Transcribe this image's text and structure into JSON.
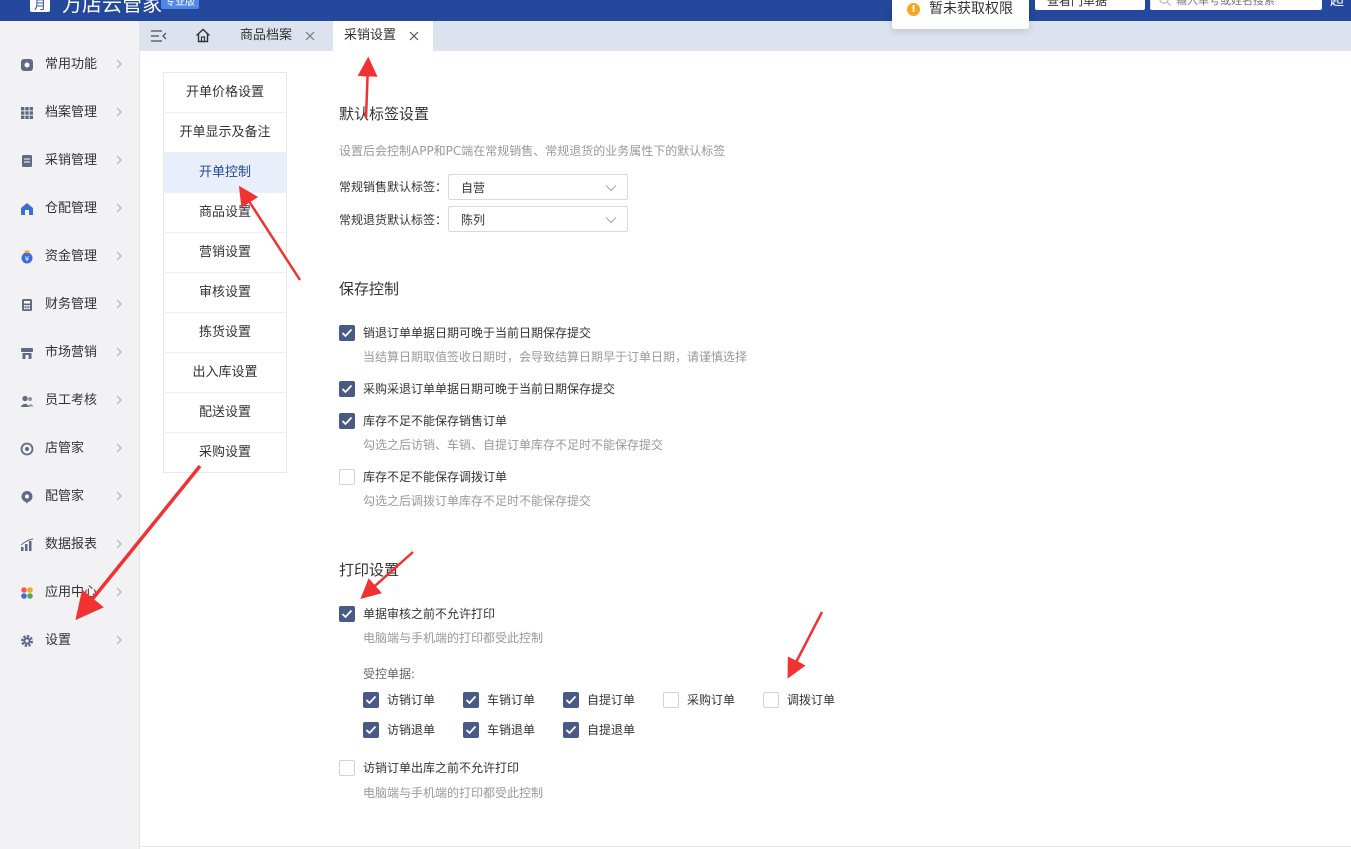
{
  "header": {
    "logo_glyph": "月",
    "brand": "万店云管家",
    "edition": "专业版",
    "store_select": "查看门单据",
    "search_placeholder": "输入单号或姓名搜索",
    "right_text": "超"
  },
  "toast": {
    "text": "暂未获取权限"
  },
  "sidebar": {
    "items": [
      {
        "label": "常用功能",
        "icon": "star-icon"
      },
      {
        "label": "档案管理",
        "icon": "grid-icon"
      },
      {
        "label": "采销管理",
        "icon": "document-icon"
      },
      {
        "label": "仓配管理",
        "icon": "warehouse-icon"
      },
      {
        "label": "资金管理",
        "icon": "money-bag-icon"
      },
      {
        "label": "财务管理",
        "icon": "calculator-icon"
      },
      {
        "label": "市场营销",
        "icon": "shop-icon"
      },
      {
        "label": "员工考核",
        "icon": "users-icon"
      },
      {
        "label": "店管家",
        "icon": "store-icon"
      },
      {
        "label": "配管家",
        "icon": "chat-icon"
      },
      {
        "label": "数据报表",
        "icon": "chart-icon"
      },
      {
        "label": "应用中心",
        "icon": "apps-icon"
      },
      {
        "label": "设置",
        "icon": "gear-icon"
      }
    ]
  },
  "tabs": [
    {
      "label": "商品档案"
    },
    {
      "label": "采销设置"
    }
  ],
  "settings_nav": [
    "开单价格设置",
    "开单显示及备注",
    "开单控制",
    "商品设置",
    "营销设置",
    "审核设置",
    "拣货设置",
    "出入库设置",
    "配送设置",
    "采购设置"
  ],
  "default_tags": {
    "title": "默认标签设置",
    "desc": "设置后会控制APP和PC端在常规销售、常规退货的业务属性下的默认标签",
    "sale_label": "常规销售默认标签：",
    "sale_value": "自营",
    "return_label": "常规退货默认标签：",
    "return_value": "陈列"
  },
  "save_control": {
    "title": "保存控制",
    "options": [
      {
        "label": "销退订单单据日期可晚于当前日期保存提交",
        "checked": true,
        "desc": "当结算日期取值签收日期时，会导致结算日期早于订单日期，请谨慎选择"
      },
      {
        "label": "采购采退订单单据日期可晚于当前日期保存提交",
        "checked": true,
        "desc": ""
      },
      {
        "label": "库存不足不能保存销售订单",
        "checked": true,
        "desc": "勾选之后访销、车销、自提订单库存不足时不能保存提交"
      },
      {
        "label": "库存不足不能保存调拨订单",
        "checked": false,
        "desc": "勾选之后调拨订单库存不足时不能保存提交"
      }
    ]
  },
  "print_settings": {
    "title": "打印设置",
    "opt1_label": "单据审核之前不允许打印",
    "opt1_desc": "电脑端与手机端的打印都受此控制",
    "controlled_label": "受控单据:",
    "docs": [
      {
        "label": "访销订单",
        "checked": true
      },
      {
        "label": "车销订单",
        "checked": true
      },
      {
        "label": "自提订单",
        "checked": true
      },
      {
        "label": "采购订单",
        "checked": false
      },
      {
        "label": "调拨订单",
        "checked": false
      },
      {
        "label": "访销退单",
        "checked": true
      },
      {
        "label": "车销退单",
        "checked": true
      },
      {
        "label": "自提退单",
        "checked": true
      }
    ],
    "opt2_label": "访销订单出库之前不允许打印",
    "opt2_desc": "电脑端与手机端的打印都受此控制"
  },
  "colors": {
    "header_bg": "#23489c",
    "checkbox_on": "#4a5a86",
    "nav_active_bg": "#e8eefa",
    "annotation_arrow": "#f03232"
  }
}
